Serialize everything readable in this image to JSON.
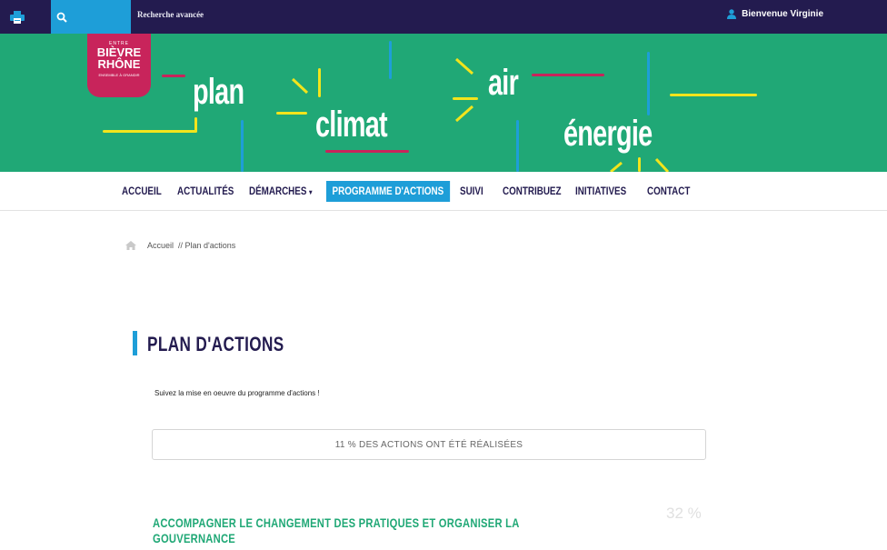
{
  "topbar": {
    "advanced_search_label": "Recherche avancée",
    "welcome_label": "Bienvenue Virginie"
  },
  "banner": {
    "logo_top": "ENTRE",
    "logo_line1": "BIÈVRE",
    "logo_line2": "RHÔNE",
    "logo_tagline": "ENSEMBLE À GRANDIR",
    "word_plan": "plan",
    "word_climat": "climat",
    "word_air": "air",
    "word_energie": "énergie"
  },
  "nav": {
    "items": [
      {
        "label": "ACCUEIL"
      },
      {
        "label": "ACTUALITÉS"
      },
      {
        "label": "DÉMARCHES"
      },
      {
        "label": "PROGRAMME D'ACTIONS"
      },
      {
        "label": "SUIVI"
      },
      {
        "label": "CONTRIBUEZ"
      },
      {
        "label": "INITIATIVES"
      },
      {
        "label": "CONTACT"
      }
    ],
    "active_index": 3
  },
  "breadcrumb": {
    "text": "Accueil  // Plan d'actions"
  },
  "main": {
    "title": "PLAN D'ACTIONS",
    "intro": "Suivez la mise en oeuvre du programme d'actions !",
    "progress_text": "11 % DES ACTIONS ONT ÉTÉ RÉALISÉES",
    "progress_value_percent": 11,
    "section": {
      "title": "ACCOMPAGNER LE CHANGEMENT DES PRATIQUES ET ORGANISER LA GOUVERNANCE",
      "percent": "32 %"
    }
  },
  "colors": {
    "topbar": "#231b4f",
    "accent_blue": "#1e9ed8",
    "banner_green": "#20a876",
    "logo_magenta": "#c8245b",
    "line_yellow": "#f2e41c"
  }
}
